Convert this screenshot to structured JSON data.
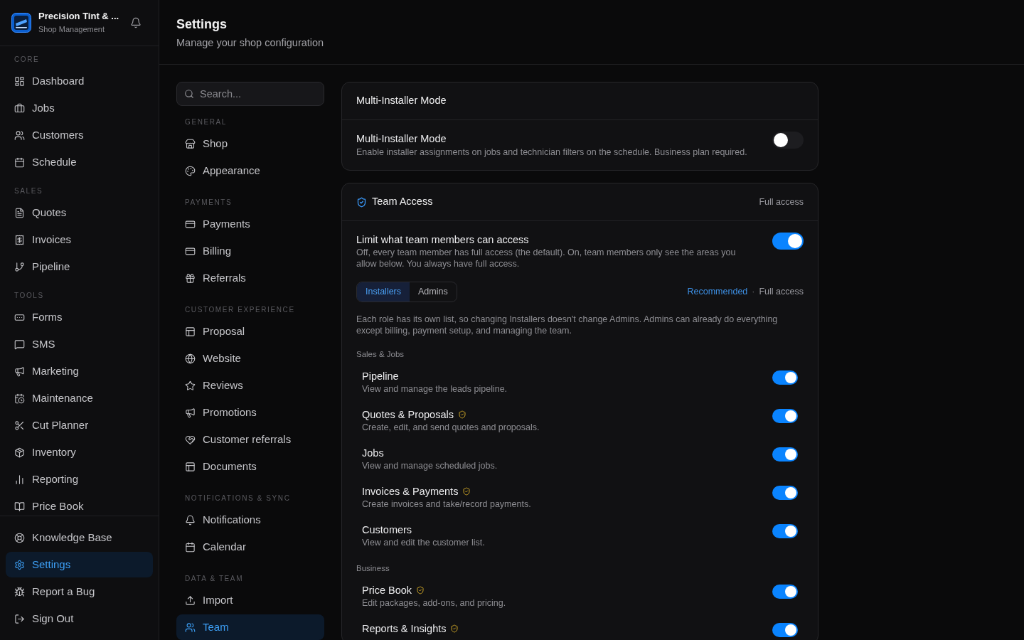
{
  "sidebar": {
    "brand": {
      "name": "Precision Tint & ...",
      "subtitle": "Shop Management"
    },
    "sections": [
      {
        "label": "CORE",
        "items": [
          {
            "label": "Dashboard",
            "selected": false
          },
          {
            "label": "Jobs",
            "selected": false
          },
          {
            "label": "Customers",
            "selected": false
          },
          {
            "label": "Schedule",
            "selected": false
          }
        ]
      },
      {
        "label": "SALES",
        "items": [
          {
            "label": "Quotes",
            "selected": false
          },
          {
            "label": "Invoices",
            "selected": false
          },
          {
            "label": "Pipeline",
            "selected": false
          }
        ]
      },
      {
        "label": "TOOLS",
        "items": [
          {
            "label": "Forms",
            "selected": false
          },
          {
            "label": "SMS",
            "selected": false
          },
          {
            "label": "Marketing",
            "selected": false
          },
          {
            "label": "Maintenance",
            "selected": false
          },
          {
            "label": "Cut Planner",
            "selected": false
          },
          {
            "label": "Inventory",
            "selected": false
          },
          {
            "label": "Reporting",
            "selected": false
          },
          {
            "label": "Price Book",
            "selected": false
          }
        ]
      }
    ],
    "footer_items": [
      {
        "label": "Knowledge Base",
        "selected": false
      },
      {
        "label": "Settings",
        "selected": true
      },
      {
        "label": "Report a Bug",
        "selected": false
      },
      {
        "label": "Sign Out",
        "selected": false
      }
    ]
  },
  "header": {
    "title": "Settings",
    "subtitle": "Manage your shop configuration"
  },
  "settings_nav": {
    "search": {
      "placeholder": "Search..."
    },
    "sections": [
      {
        "label": "GENERAL",
        "items": [
          {
            "label": "Shop",
            "selected": false
          },
          {
            "label": "Appearance",
            "selected": false
          }
        ]
      },
      {
        "label": "PAYMENTS",
        "items": [
          {
            "label": "Payments",
            "selected": false
          },
          {
            "label": "Billing",
            "selected": false
          },
          {
            "label": "Referrals",
            "selected": false
          }
        ]
      },
      {
        "label": "CUSTOMER EXPERIENCE",
        "items": [
          {
            "label": "Proposal",
            "selected": false
          },
          {
            "label": "Website",
            "selected": false
          },
          {
            "label": "Reviews",
            "selected": false
          },
          {
            "label": "Promotions",
            "selected": false
          },
          {
            "label": "Customer referrals",
            "selected": false
          },
          {
            "label": "Documents",
            "selected": false
          }
        ]
      },
      {
        "label": "NOTIFICATIONS & SYNC",
        "items": [
          {
            "label": "Notifications",
            "selected": false
          },
          {
            "label": "Calendar",
            "selected": false
          }
        ]
      },
      {
        "label": "DATA & TEAM",
        "items": [
          {
            "label": "Import",
            "selected": false
          },
          {
            "label": "Team",
            "selected": true
          }
        ]
      }
    ]
  },
  "multi_installer_card": {
    "title": "Multi-Installer Mode",
    "setting": {
      "label": "Multi-Installer Mode",
      "description": "Enable installer assignments on jobs and technician filters on the schedule. Business plan required.",
      "on": false
    }
  },
  "team_access_card": {
    "title": "Team Access",
    "status": "Full access",
    "setting": {
      "label": "Limit what team members can access",
      "description": "Off, every team member has full access (the default). On, team members only see the areas you allow below. You always have full access.",
      "on": true
    },
    "roles": [
      {
        "label": "Installers",
        "selected": true
      },
      {
        "label": "Admins",
        "selected": false
      }
    ],
    "preset": {
      "link": "Recommended",
      "separator": "·",
      "status": "Full access"
    },
    "note": "Each role has its own list, so changing Installers doesn't change Admins. Admins can already do everything except billing, payment setup, and managing the team.",
    "groups": [
      {
        "label": "Sales & Jobs",
        "permissions": [
          {
            "label": "Pipeline",
            "description": "View and manage the leads pipeline.",
            "sensitive": false,
            "on": true
          },
          {
            "label": "Quotes & Proposals",
            "description": "Create, edit, and send quotes and proposals.",
            "sensitive": true,
            "on": true
          },
          {
            "label": "Jobs",
            "description": "View and manage scheduled jobs.",
            "sensitive": false,
            "on": true
          },
          {
            "label": "Invoices & Payments",
            "description": "Create invoices and take/record payments.",
            "sensitive": true,
            "on": true
          },
          {
            "label": "Customers",
            "description": "View and edit the customer list.",
            "sensitive": false,
            "on": true
          }
        ]
      },
      {
        "label": "Business",
        "permissions": [
          {
            "label": "Price Book",
            "description": "Edit packages, add-ons, and pricing.",
            "sensitive": true,
            "on": true
          },
          {
            "label": "Reports & Insights",
            "sensitive": true,
            "on": true
          }
        ]
      }
    ]
  }
}
